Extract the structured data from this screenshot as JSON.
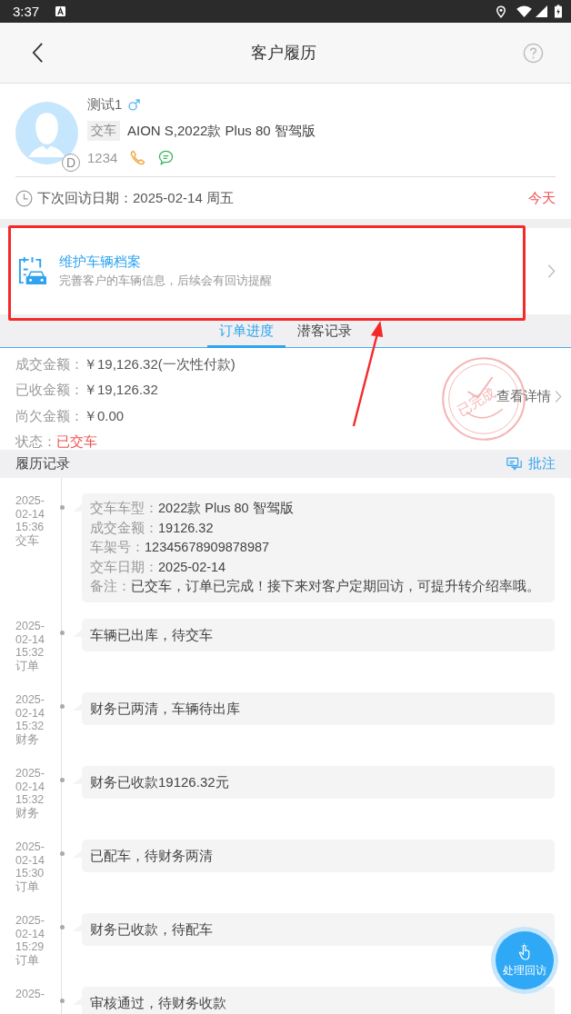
{
  "status_bar": {
    "time": "3:37"
  },
  "header": {
    "title": "客户履历"
  },
  "customer": {
    "name": "测试1",
    "avatar_badge": "D",
    "stage_tag": "交车",
    "vehicle": "AION S,2022款 Plus 80 智驾版",
    "phone": "1234"
  },
  "next_visit": {
    "label": "下次回访日期：2025-02-14 周五",
    "badge": "今天"
  },
  "vehicle_card": {
    "title": "维护车辆档案",
    "subtitle": "完善客户的车辆信息，后续会有回访提醒"
  },
  "tabs": [
    {
      "label": "订单进度",
      "selected": true
    },
    {
      "label": "潜客记录",
      "selected": false
    }
  ],
  "order": {
    "rows": [
      {
        "label": "成交金额：",
        "value": "￥19,126.32(一次性付款)",
        "kind": "plain"
      },
      {
        "label": "已收金额：",
        "value": "￥19,126.32",
        "kind": "plain"
      },
      {
        "label": "尚欠金额：",
        "value": "￥0.00",
        "kind": "plain"
      },
      {
        "label": "状态：",
        "value": "已交车",
        "kind": "alert"
      }
    ],
    "stamp": "已完成",
    "details_link": "查看详情"
  },
  "records": {
    "title": "履历记录",
    "action": "批注",
    "items": [
      {
        "date": "2025-",
        "day": "02-14",
        "time": "15:36",
        "type": "交车",
        "lines": [
          {
            "label": "交车车型：",
            "value": "2022款 Plus 80 智驾版"
          },
          {
            "label": "成交金额：",
            "value": "19126.32"
          },
          {
            "label": "车架号：",
            "value": "12345678909878987"
          },
          {
            "label": "交车日期：",
            "value": "2025-02-14"
          },
          {
            "label": "备注：",
            "value": "已交车，订单已完成！接下来对客户定期回访，可提升转介绍率哦。"
          }
        ]
      },
      {
        "date": "2025-",
        "day": "02-14",
        "time": "15:32",
        "type": "订单",
        "text": "车辆已出库，待交车"
      },
      {
        "date": "2025-",
        "day": "02-14",
        "time": "15:32",
        "type": "财务",
        "text": "财务已两清，车辆待出库"
      },
      {
        "date": "2025-",
        "day": "02-14",
        "time": "15:32",
        "type": "财务",
        "text": "财务已收款19126.32元"
      },
      {
        "date": "2025-",
        "day": "02-14",
        "time": "15:30",
        "type": "订单",
        "text": "已配车，待财务两清"
      },
      {
        "date": "2025-",
        "day": "02-14",
        "time": "15:29",
        "type": "订单",
        "text": "财务已收款，待配车"
      },
      {
        "date": "2025-",
        "text": "审核通过，待财务收款"
      }
    ]
  },
  "fab": {
    "label": "处理回访"
  },
  "annotations": [
    {
      "kind": "frame"
    },
    {
      "kind": "arrow"
    }
  ]
}
